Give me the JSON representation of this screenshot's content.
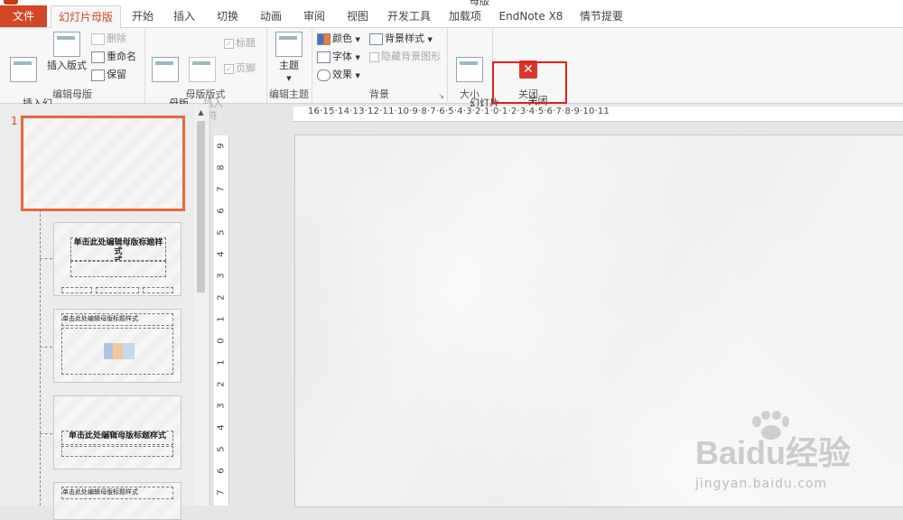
{
  "window": {
    "title_fragment": "母版"
  },
  "tabs": [
    "文件",
    "幻灯片母版",
    "开始",
    "插入",
    "切换",
    "动画",
    "审阅",
    "视图",
    "开发工具",
    "加载项",
    "EndNote X8",
    "情节提要"
  ],
  "ribbon": {
    "edit_master": {
      "label": "编辑母版",
      "insert_slide_master": "插入幻\n灯片母版",
      "insert_layout": "插入版式",
      "delete": "删除",
      "rename": "重命名",
      "preserve": "保留"
    },
    "master_layout": {
      "label": "母版版式",
      "master_layout_btn": "母版\n版式",
      "insert_placeholder": "插入\n占位符",
      "title_check": "标题",
      "footer_check": "页脚"
    },
    "edit_theme": {
      "label": "编辑主题",
      "themes": "主题"
    },
    "background": {
      "label": "背景",
      "colors": "颜色",
      "fonts": "字体",
      "effects": "效果",
      "bg_styles": "背景样式",
      "hide_bg": "隐藏背景图形"
    },
    "size": {
      "label": "大小",
      "slide_size": "幻灯片\n大小"
    },
    "close": {
      "label": "关闭",
      "close_master": "关闭\n母版视图"
    }
  },
  "slides_panel": {
    "selected_number": "1",
    "layout_title_text": "单击此处编辑母版标题样式",
    "layout_title_text_short": "单击此处编辑母版标题样式",
    "layout_title_suffix": "式"
  },
  "ruler_h": "16·15·14·13·12·11·10·9·8·7·6·5·4·3·2·1·0·1·2·3·4·5·6·7·8·9·10·11",
  "ruler_v": [
    "9",
    "8",
    "7",
    "6",
    "5",
    "4",
    "3",
    "2",
    "1",
    "0",
    "1",
    "2",
    "3",
    "4",
    "5",
    "6",
    "7"
  ],
  "watermark": {
    "main": "Baidu经验",
    "sub": "jingyan.baidu.com"
  },
  "colors": {
    "accent": "#d24726",
    "highlight": "#e0211b",
    "selection": "#e8683e"
  }
}
